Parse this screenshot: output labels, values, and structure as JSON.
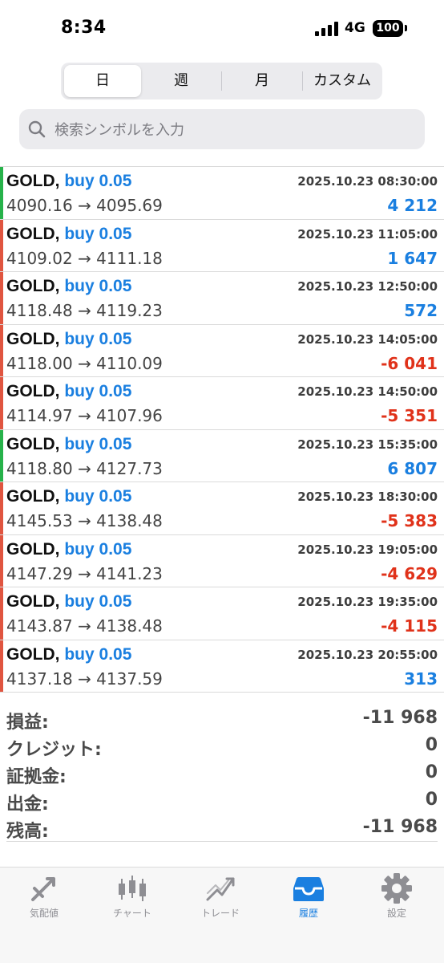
{
  "status_bar": {
    "time": "8:34",
    "network": "4G",
    "battery": "100"
  },
  "period_tabs": [
    {
      "label": "日",
      "active": true
    },
    {
      "label": "週",
      "active": false
    },
    {
      "label": "月",
      "active": false
    },
    {
      "label": "カスタム",
      "active": false
    }
  ],
  "search": {
    "placeholder": "検索シンボルを入力"
  },
  "deals": [
    {
      "symbol": "GOLD,",
      "trade": "buy 0.05",
      "time": "2025.10.23 08:30:00",
      "prices": "4090.16 → 4095.69",
      "profit": "4 212",
      "profit_sign": "positive",
      "bar_color": "#27b24a"
    },
    {
      "symbol": "GOLD,",
      "trade": "buy 0.05",
      "time": "2025.10.23 11:05:00",
      "prices": "4109.02 → 4111.18",
      "profit": "1 647",
      "profit_sign": "positive",
      "bar_color": "#e05540"
    },
    {
      "symbol": "GOLD,",
      "trade": "buy 0.05",
      "time": "2025.10.23 12:50:00",
      "prices": "4118.48 → 4119.23",
      "profit": "572",
      "profit_sign": "positive",
      "bar_color": "#e05540"
    },
    {
      "symbol": "GOLD,",
      "trade": "buy 0.05",
      "time": "2025.10.23 14:05:00",
      "prices": "4118.00 → 4110.09",
      "profit": "-6 041",
      "profit_sign": "negative",
      "bar_color": "#e05540"
    },
    {
      "symbol": "GOLD,",
      "trade": "buy 0.05",
      "time": "2025.10.23 14:50:00",
      "prices": "4114.97 → 4107.96",
      "profit": "-5 351",
      "profit_sign": "negative",
      "bar_color": "#e05540"
    },
    {
      "symbol": "GOLD,",
      "trade": "buy 0.05",
      "time": "2025.10.23 15:35:00",
      "prices": "4118.80 → 4127.73",
      "profit": "6 807",
      "profit_sign": "positive",
      "bar_color": "#27b24a"
    },
    {
      "symbol": "GOLD,",
      "trade": "buy 0.05",
      "time": "2025.10.23 18:30:00",
      "prices": "4145.53 → 4138.48",
      "profit": "-5 383",
      "profit_sign": "negative",
      "bar_color": "#e05540"
    },
    {
      "symbol": "GOLD,",
      "trade": "buy 0.05",
      "time": "2025.10.23 19:05:00",
      "prices": "4147.29 → 4141.23",
      "profit": "-4 629",
      "profit_sign": "negative",
      "bar_color": "#e05540"
    },
    {
      "symbol": "GOLD,",
      "trade": "buy 0.05",
      "time": "2025.10.23 19:35:00",
      "prices": "4143.87 → 4138.48",
      "profit": "-4 115",
      "profit_sign": "negative",
      "bar_color": "#e05540"
    },
    {
      "symbol": "GOLD,",
      "trade": "buy 0.05",
      "time": "2025.10.23 20:55:00",
      "prices": "4137.18 → 4137.59",
      "profit": "313",
      "profit_sign": "positive",
      "bar_color": "#e05540"
    }
  ],
  "summary": [
    {
      "label": "損益:",
      "value": "-11 968"
    },
    {
      "label": "クレジット:",
      "value": "0"
    },
    {
      "label": "証拠金:",
      "value": "0"
    },
    {
      "label": "出金:",
      "value": "0"
    },
    {
      "label": "残高:",
      "value": "-11 968"
    }
  ],
  "tab_bar": [
    {
      "label": "気配値",
      "icon": "quotes-icon",
      "active": false
    },
    {
      "label": "チャート",
      "icon": "chart-icon",
      "active": false
    },
    {
      "label": "トレード",
      "icon": "trade-icon",
      "active": false
    },
    {
      "label": "履歴",
      "icon": "history-icon",
      "active": true
    },
    {
      "label": "設定",
      "icon": "settings-icon",
      "active": false
    }
  ],
  "colors": {
    "accent": "#1a7fe0",
    "negative": "#e0321a",
    "positive_bar": "#27b24a",
    "negative_bar": "#e05540"
  }
}
